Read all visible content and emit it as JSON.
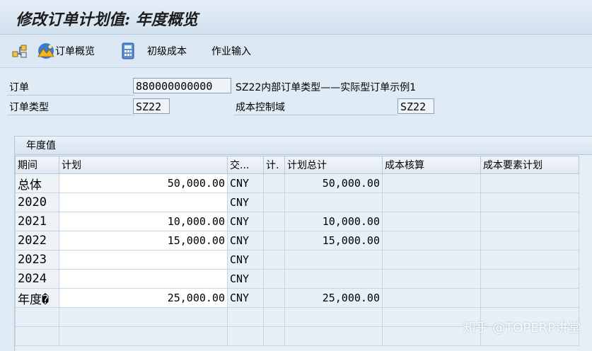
{
  "window": {
    "title": "修改订单计划值: 年度概览"
  },
  "toolbar": {
    "items": [
      {
        "icon": "hierarchy-icon",
        "label": ""
      },
      {
        "icon": "chart-mountain-icon",
        "label": "订单概览"
      },
      {
        "icon": "calculator-icon",
        "label": "初级成本"
      },
      {
        "icon": "",
        "label": "作业输入"
      }
    ]
  },
  "header": {
    "order_label": "订单",
    "order_value": "880000000000",
    "order_desc": "SZ22内部订单类型——实际型订单示例1",
    "order_type_label": "订单类型",
    "order_type_value": "SZ22",
    "controlling_area_label": "成本控制域",
    "controlling_area_value": "SZ22"
  },
  "panel": {
    "title": "年度值",
    "columns": [
      "期间",
      "计划",
      "交...",
      "计.",
      "计划总计",
      "成本核算",
      "成本要素计划"
    ],
    "rows": [
      {
        "period": "总体",
        "plan": "50,000.00",
        "currency": "CNY",
        "total": "50,000.00"
      },
      {
        "period": "2020",
        "plan": "",
        "currency": "CNY",
        "total": ""
      },
      {
        "period": "2021",
        "plan": "10,000.00",
        "currency": "CNY",
        "total": "10,000.00"
      },
      {
        "period": "2022",
        "plan": "15,000.00",
        "currency": "CNY",
        "total": "15,000.00"
      },
      {
        "period": "2023",
        "plan": "",
        "currency": "CNY",
        "total": ""
      },
      {
        "period": "2024",
        "plan": "",
        "currency": "CNY",
        "total": ""
      },
      {
        "period": "年度�",
        "plan": "25,000.00",
        "currency": "CNY",
        "total": "25,000.00"
      }
    ]
  },
  "watermark": "知乎 @TOPERP讲堂"
}
